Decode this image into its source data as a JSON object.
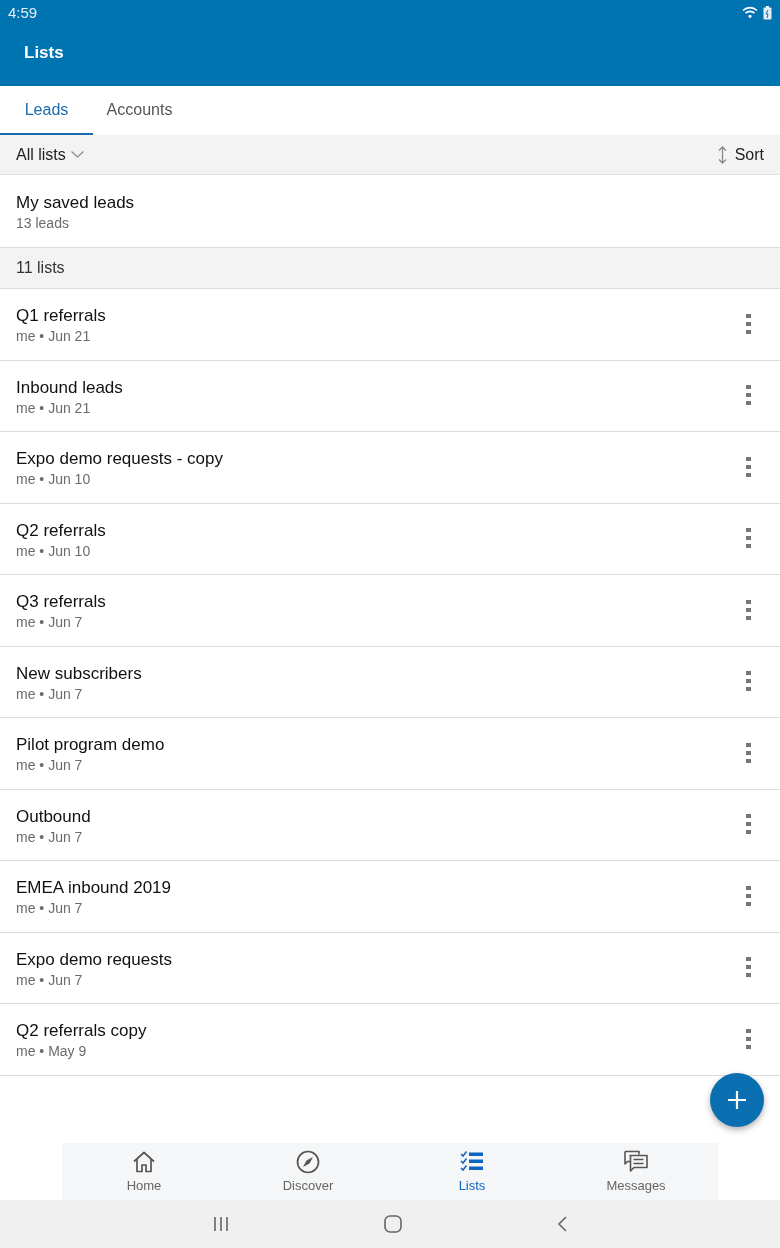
{
  "status_bar": {
    "time": "4:59"
  },
  "app_bar": {
    "title": "Lists"
  },
  "tabs": [
    {
      "label": "Leads",
      "selected": true
    },
    {
      "label": "Accounts",
      "selected": false
    }
  ],
  "filter_bar": {
    "filter": "All lists",
    "sort": "Sort"
  },
  "saved": {
    "title": "My saved leads",
    "count": "13 leads"
  },
  "section": {
    "label": "11 lists"
  },
  "lists": [
    {
      "name": "Q1 referrals",
      "meta": "me • Jun 21"
    },
    {
      "name": "Inbound leads",
      "meta": "me • Jun 21"
    },
    {
      "name": "Expo demo requests - copy",
      "meta": "me • Jun 10"
    },
    {
      "name": "Q2 referrals",
      "meta": "me • Jun 10"
    },
    {
      "name": "Q3 referrals",
      "meta": "me • Jun 7"
    },
    {
      "name": "New subscribers",
      "meta": "me • Jun 7"
    },
    {
      "name": "Pilot program demo",
      "meta": "me • Jun 7"
    },
    {
      "name": "Outbound",
      "meta": "me • Jun 7"
    },
    {
      "name": "EMEA inbound 2019",
      "meta": "me • Jun 7"
    },
    {
      "name": "Expo demo requests",
      "meta": "me • Jun 7"
    },
    {
      "name": "Q2 referrals copy",
      "meta": "me • May 9"
    }
  ],
  "bottom_nav": [
    {
      "kind": "home",
      "label": "Home",
      "selected": false
    },
    {
      "kind": "discover",
      "label": "Discover",
      "selected": false
    },
    {
      "kind": "lists",
      "label": "Lists",
      "selected": true
    },
    {
      "kind": "messages",
      "label": "Messages",
      "selected": false
    }
  ]
}
